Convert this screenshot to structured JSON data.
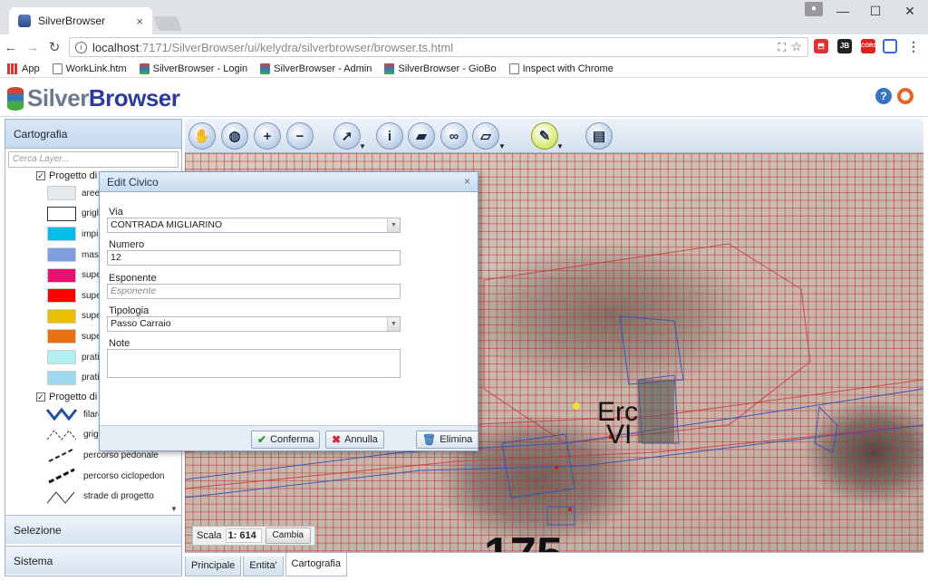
{
  "browser": {
    "tab_title": "SilverBrowser",
    "tab_close": "×",
    "url_host": "localhost",
    "url_rest": ":7171/SilverBrowser/ui/kelydra/silverbrowser/browser.ts.html",
    "bookmarks": [
      {
        "label": "App",
        "icon": "apps-grid-icon"
      },
      {
        "label": "WorkLink.htm",
        "icon": "page-icon"
      },
      {
        "label": "SilverBrowser - Login",
        "icon": "database-icon"
      },
      {
        "label": "SilverBrowser - Admin",
        "icon": "database-icon"
      },
      {
        "label": "SilverBrowser - GioBo",
        "icon": "database-icon"
      },
      {
        "label": "Inspect with Chrome",
        "icon": "page-icon"
      }
    ],
    "ext_labels": [
      "JB",
      "CORS"
    ]
  },
  "app": {
    "logo_grey": "Silver",
    "logo_blue": "Browser",
    "help": "?"
  },
  "left_panel": {
    "cartografia": "Cartografia",
    "search_placeholder": "Cerca Layer...",
    "group1_label": "Progetto di",
    "group1_check": "✓",
    "group2_label": "Progetto di",
    "group2_check": "✓",
    "layers_group1": [
      {
        "label": "aree",
        "color": "#e4e9ee"
      },
      {
        "label": "grigl",
        "color": "#ffffff"
      },
      {
        "label": "impi",
        "color": "#00bfe8"
      },
      {
        "label": "mas",
        "color": "#7f9ee0"
      },
      {
        "label": "supe",
        "color": "#e8106f"
      },
      {
        "label": "supe",
        "color": "#ff0000"
      },
      {
        "label": "supe",
        "color": "#e8c000"
      },
      {
        "label": "supe",
        "color": "#e87010"
      },
      {
        "label": "prati",
        "color": "#b0eef0"
      },
      {
        "label": "prati",
        "color": "#9cd8ee"
      }
    ],
    "layers_group2": [
      {
        "label": "filare",
        "style": "wave"
      },
      {
        "label": "grigli",
        "style": "dash-zig"
      },
      {
        "label": "percorso pedonale",
        "style": "dash"
      },
      {
        "label": "percorso ciclopedon",
        "style": "dash-bold"
      },
      {
        "label": "strade di progetto",
        "style": "zig"
      }
    ],
    "selezione": "Selezione",
    "sistema": "Sistema"
  },
  "toolbar": {
    "tools": [
      {
        "name": "pan-hand-icon",
        "glyph": "✋"
      },
      {
        "name": "globe-icon",
        "glyph": "◍"
      },
      {
        "name": "zoom-in-icon",
        "glyph": "+"
      },
      {
        "name": "zoom-out-icon",
        "glyph": "−"
      },
      {
        "name": "select-arrow-icon",
        "glyph": "➚"
      },
      {
        "name": "info-icon",
        "glyph": "i"
      },
      {
        "name": "eraser-icon",
        "glyph": "▰"
      },
      {
        "name": "binoculars-icon",
        "glyph": "∞"
      },
      {
        "name": "ruler-icon",
        "glyph": "▱"
      },
      {
        "name": "pencil-icon",
        "glyph": "✎"
      },
      {
        "name": "printer-icon",
        "glyph": "▤"
      }
    ]
  },
  "map": {
    "scale_label": "Scala",
    "scale_value": "1: 614",
    "cambia": "Cambia",
    "map_text_1": "Erc",
    "map_text_2": "VI",
    "map_text_3": "175"
  },
  "bottom_tabs": [
    {
      "label": "Principale",
      "active": false
    },
    {
      "label": "Entita'",
      "active": false
    },
    {
      "label": "Cartografia",
      "active": true
    }
  ],
  "dialog": {
    "title": "Edit Civico",
    "close": "×",
    "via_label": "Via",
    "via_value": "CONTRADA MIGLIARINO",
    "numero_label": "Numero",
    "numero_value": "12",
    "esponente_label": "Esponente",
    "esponente_placeholder": "Esponente",
    "tipologia_label": "Tipologia",
    "tipologia_value": "Passo Carraio",
    "note_label": "Note",
    "conferma": "Conferma",
    "annulla": "Annulla",
    "elimina": "Elimina"
  }
}
